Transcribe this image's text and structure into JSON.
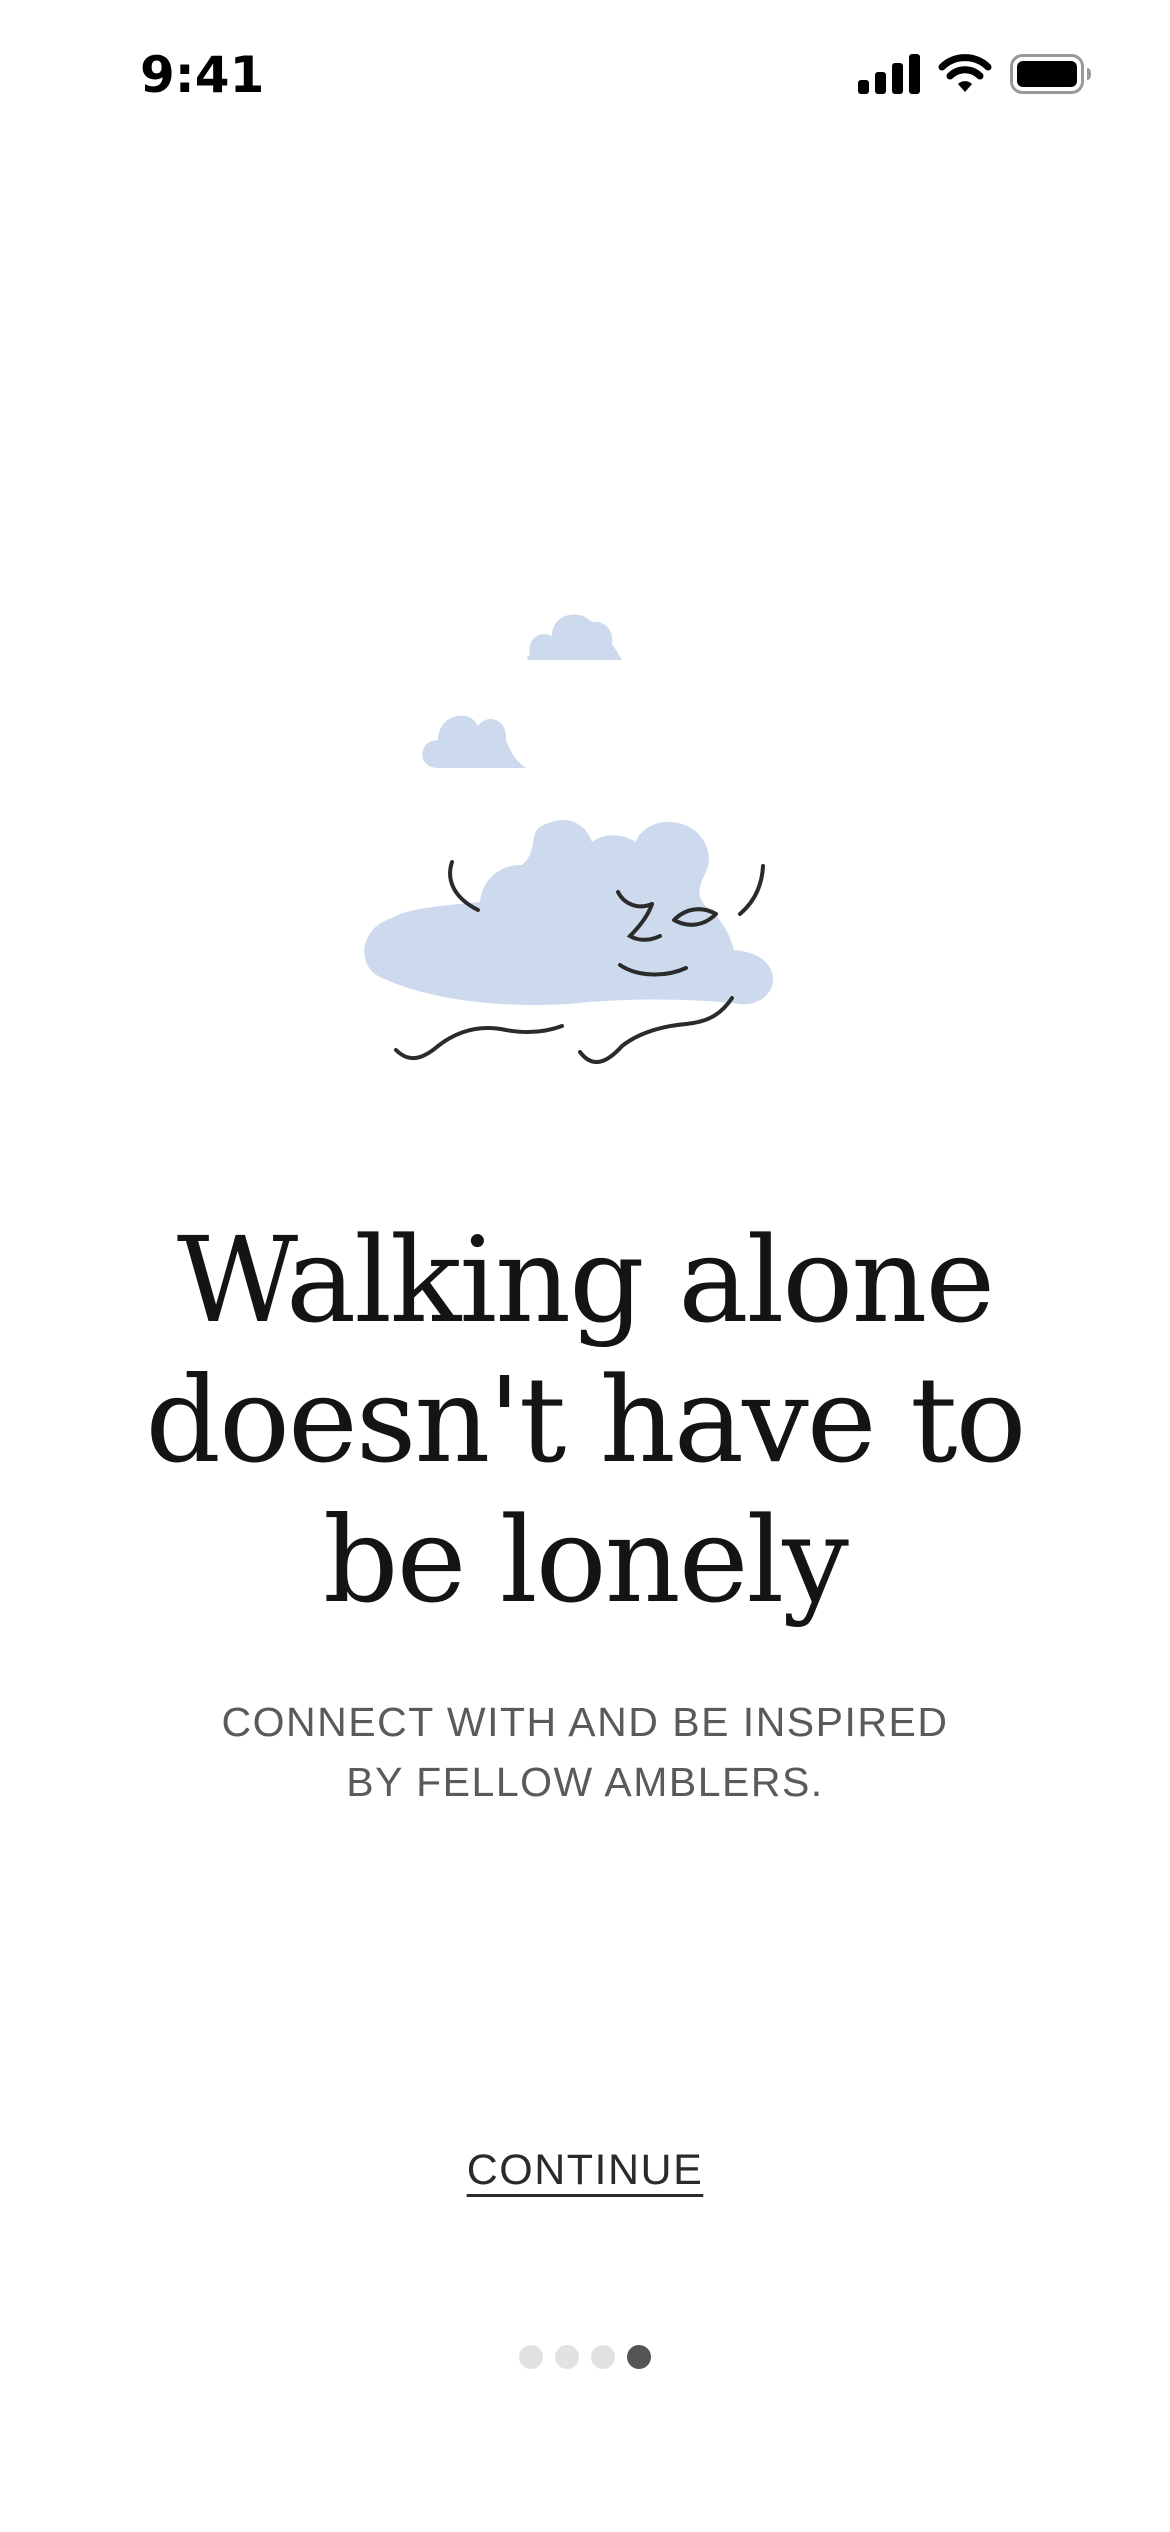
{
  "status_bar": {
    "time": "9:41",
    "icons": [
      "cellular-signal-icon",
      "wifi-icon",
      "battery-icon"
    ]
  },
  "illustration": {
    "icon": "sleeping-cloud-illustration",
    "colors": {
      "cloud": "#cddaee",
      "line": "#2b2b2b"
    }
  },
  "onboarding": {
    "headline_lines": [
      "Walking alone",
      "doesn't have to",
      "be lonely"
    ],
    "subheadline_lines": [
      "CONNECT WITH AND BE INSPIRED",
      "BY FELLOW AMBLERS."
    ],
    "continue_label": "CONTINUE"
  },
  "pagination": {
    "total": 4,
    "current": 4,
    "colors": {
      "inactive": "#e2e2e2",
      "active": "#555555"
    }
  }
}
